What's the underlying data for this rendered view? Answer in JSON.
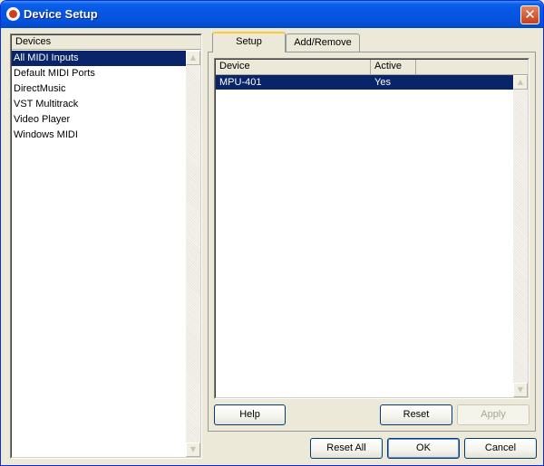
{
  "window": {
    "title": "Device Setup",
    "close_glyph": "✕"
  },
  "devices": {
    "header": "Devices",
    "items": [
      {
        "label": "All MIDI Inputs",
        "selected": true
      },
      {
        "label": "Default MIDI Ports"
      },
      {
        "label": "DirectMusic"
      },
      {
        "label": "VST Multitrack"
      },
      {
        "label": "Video Player"
      },
      {
        "label": "Windows MIDI"
      }
    ]
  },
  "tabs": [
    {
      "label": "Setup",
      "active": true
    },
    {
      "label": "Add/Remove"
    }
  ],
  "table": {
    "columns": [
      "Device",
      "Active"
    ],
    "rows": [
      {
        "device": "MPU-401",
        "active": "Yes",
        "selected": true
      }
    ]
  },
  "scroll_glyphs": {
    "up": "▲",
    "down": "▼"
  },
  "tab_buttons": {
    "help": "Help",
    "reset": "Reset",
    "apply": "Apply"
  },
  "footer_buttons": {
    "reset_all": "Reset All",
    "ok": "OK",
    "cancel": "Cancel"
  },
  "icons": {
    "app": "cubase-icon",
    "close": "close-icon"
  },
  "colors": {
    "selection": "#0A246A",
    "titlebar": "#0653DD",
    "active_tab": "#FFC83C"
  }
}
